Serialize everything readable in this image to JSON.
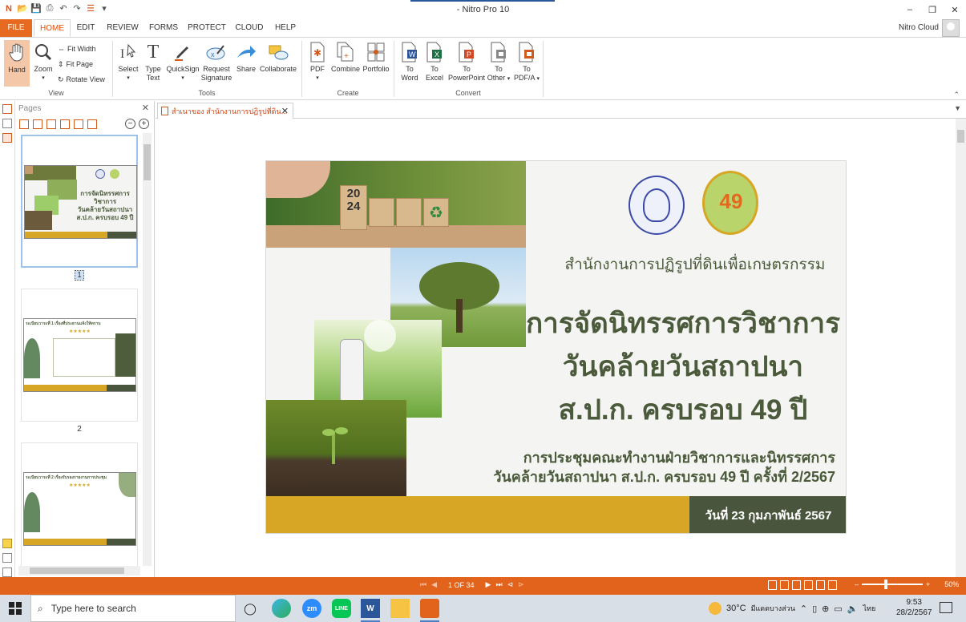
{
  "window": {
    "title": "- Nitro Pro 10",
    "controls": [
      "–",
      "❐",
      "✕"
    ]
  },
  "ribbon_tabs": [
    "FILE",
    "HOME",
    "EDIT",
    "REVIEW",
    "FORMS",
    "PROTECT",
    "CLOUD",
    "HELP"
  ],
  "active_tab": "HOME",
  "account": {
    "label": "Nitro Cloud"
  },
  "ribbon": {
    "view": {
      "label": "View",
      "hand": "Hand",
      "zoom": "Zoom",
      "fit_width": "Fit Width",
      "fit_page": "Fit Page",
      "rotate_view": "Rotate View"
    },
    "tools": {
      "label": "Tools",
      "select": "Select",
      "type_text": [
        "Type",
        "Text"
      ],
      "quicksign": "QuickSign",
      "request_signature": [
        "Request",
        "Signature"
      ],
      "share": "Share",
      "collaborate": "Collaborate"
    },
    "create": {
      "label": "Create",
      "pdf": "PDF",
      "combine": "Combine",
      "portfolio": "Portfolio"
    },
    "convert": {
      "label": "Convert",
      "to_word": [
        "To",
        "Word"
      ],
      "to_excel": [
        "To",
        "Excel"
      ],
      "to_powerpoint": [
        "To",
        "PowerPoint"
      ],
      "to_other": [
        "To",
        "Other"
      ],
      "to_pdfa": [
        "To",
        "PDF/A"
      ]
    }
  },
  "pages_panel": {
    "title": "Pages",
    "thumbnails": [
      {
        "label": "1",
        "selected": true
      },
      {
        "label": "2",
        "selected": false
      },
      {
        "label": "3",
        "selected": false
      }
    ],
    "thumb_text": {
      "t1_title": [
        "การจัดนิทรรศการวิชาการ",
        "วันคล้ายวันสถาปนา",
        "ส.ป.ก. ครบรอบ 49 ปี"
      ],
      "t2_heading": "ระเบียบวาระที่ 1 เรื่องที่ประธานแจ้งให้ทราบ",
      "t3_heading": "ระเบียบวาระที่ 2 เรื่องรับรองรายงานการประชุม"
    }
  },
  "document": {
    "tab_title": "สำเนาของ สำนักงานการปฏิรูปที่ดิน...",
    "slide": {
      "org_name": "สำนักงานการปฏิรูปที่ดินเพื่อเกษตรกรรม",
      "title_lines": [
        "การจัดนิทรรศการวิชาการ",
        "วันคล้ายวันสถาปนา",
        "ส.ป.ก. ครบรอบ 49 ปี"
      ],
      "subtitle_lines": [
        "การประชุมคณะทำงานฝ่ายวิชาการและนิทรรศการ",
        "วันคล้ายวันสถาปนา ส.ป.ก. ครบรอบ 49 ปี ครั้งที่ 2/2567"
      ],
      "date": "วันที่ 23 กุมภาพันธ์ 2567",
      "cube_year": [
        "20",
        "24"
      ],
      "badge_number": "49",
      "colors": {
        "olive": "#49553c",
        "gold": "#d6a624",
        "title_text": "#4a5a3a"
      }
    }
  },
  "status": {
    "page_indicator": "1 OF 34",
    "zoom": "50%",
    "bar_color": "#e2631c",
    "zoom_minus": "–",
    "zoom_plus": "+"
  },
  "taskbar": {
    "search_placeholder": "Type here to search",
    "weather": "30°C",
    "weather_desc": "มีแดดบางส่วน",
    "language": "ไทย",
    "time": "9:53",
    "date": "28/2/2567",
    "apps": [
      "task-view",
      "edge",
      "zoom",
      "line",
      "word",
      "file-explorer",
      "nitro"
    ],
    "zoom_label": "zm",
    "line_label": "LINE",
    "word_label": "W"
  }
}
